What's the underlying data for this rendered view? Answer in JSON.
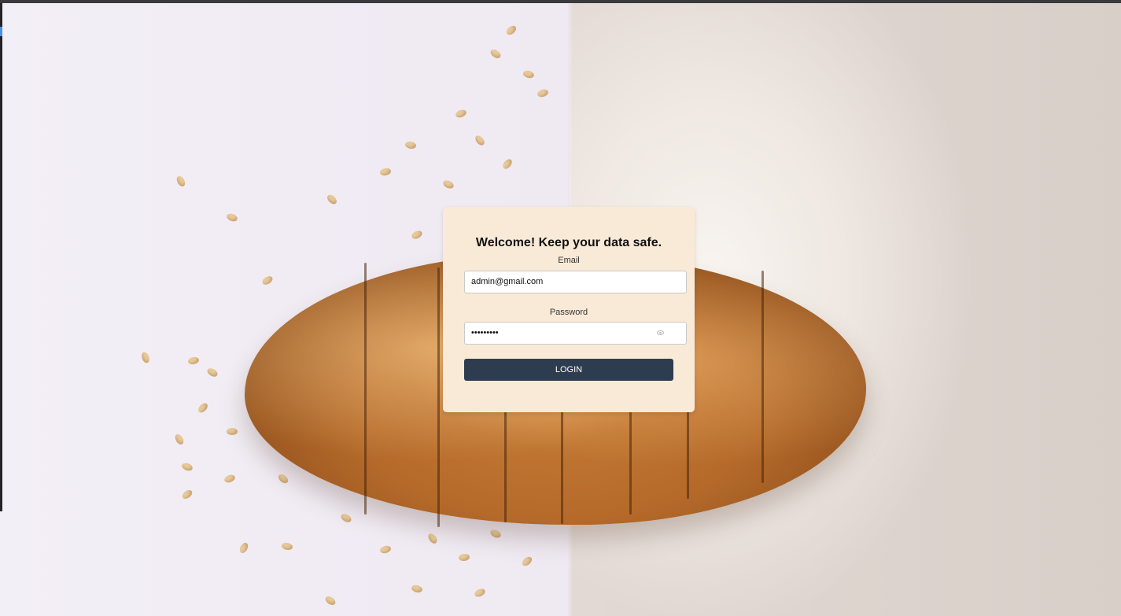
{
  "login": {
    "title": "Welcome! Keep your data safe.",
    "email_label": "Email",
    "email_value": "admin@gmail.com",
    "password_label": "Password",
    "password_value": "•••••••••",
    "login_button": "LOGIN"
  }
}
